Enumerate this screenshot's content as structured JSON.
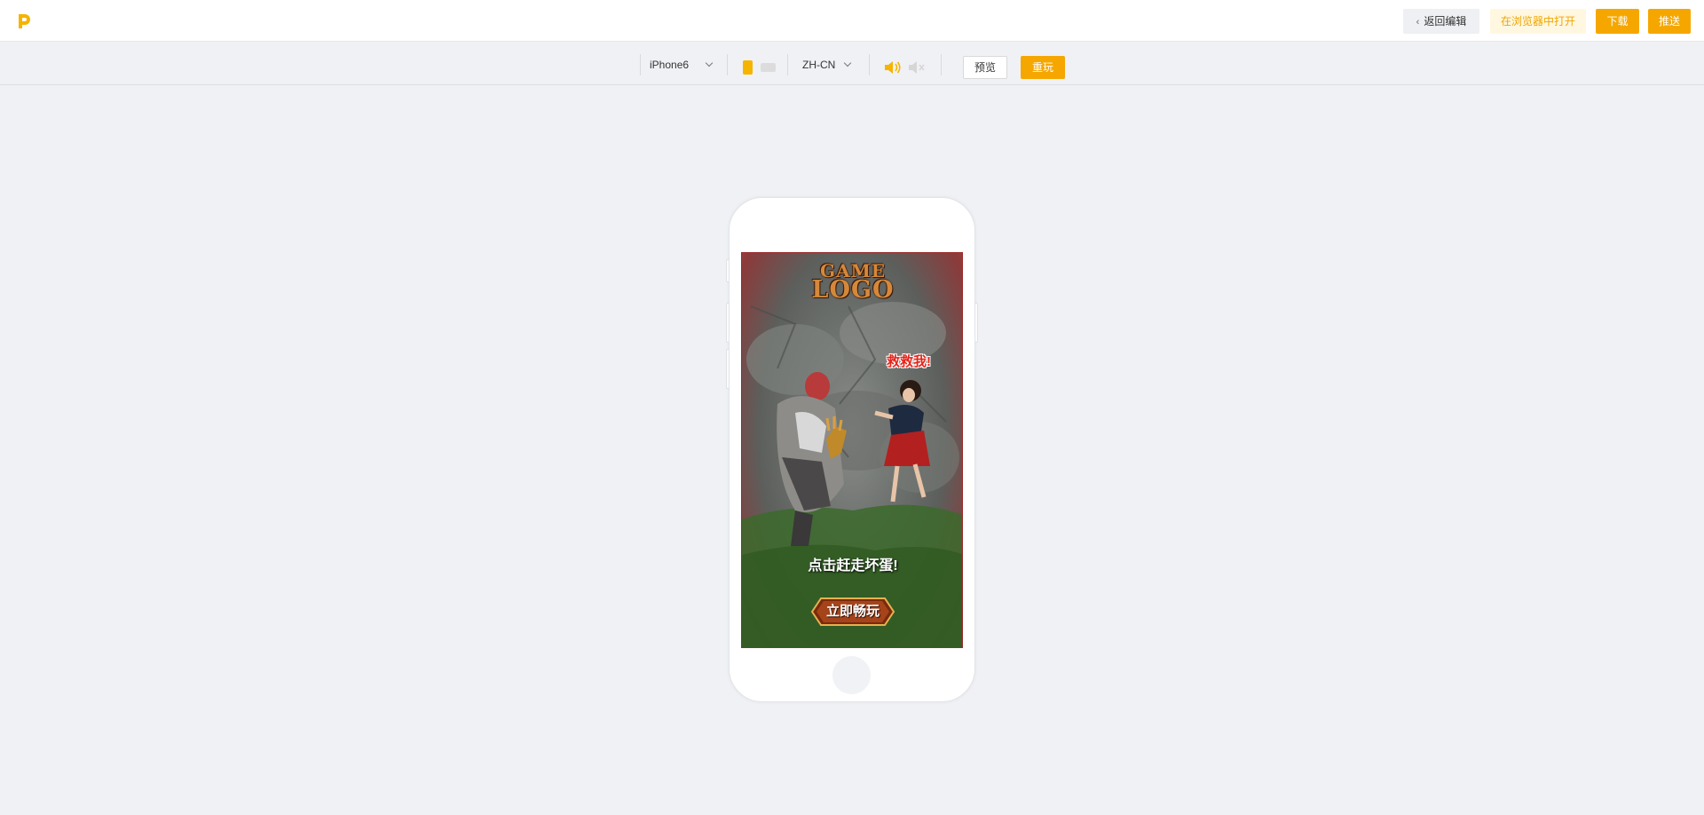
{
  "header": {
    "back_label": "返回编辑",
    "open_in_browser_label": "在浏览器中打开",
    "download_label": "下载",
    "push_label": "推送"
  },
  "toolbar": {
    "device": "iPhone6",
    "language": "ZH-CN",
    "preview_label": "预览",
    "replay_label": "重玩",
    "orientation_selected": "portrait",
    "sound_selected": "on"
  },
  "game": {
    "logo_line1": "GAME",
    "logo_line2": "LOGO",
    "rescue_text": "救救我!",
    "hint_text": "点击赶走坏蛋!",
    "play_label": "立即畅玩"
  },
  "colors": {
    "accent": "#f5a700",
    "accent_light_bg": "#fff7e0",
    "page_bg": "#f0f1f5"
  }
}
